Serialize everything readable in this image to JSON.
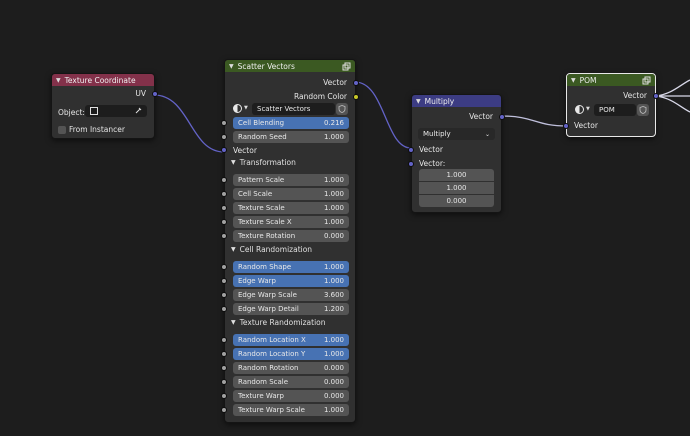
{
  "colors": {
    "background": "#1d1d1d",
    "node_body": "#303030",
    "header_input": "#83314a",
    "header_group": "#3b5922",
    "header_vector": "#3c3c83",
    "socket_vector": "#6363c7",
    "socket_color": "#c7c729",
    "socket_float": "#a1a1a1",
    "field_selected": "#4772b3",
    "field_default": "#545454"
  },
  "texture_coordinate": {
    "title": "Texture Coordinate",
    "output_uv": "UV",
    "object_label": "Object:",
    "from_instancer": "From Instancer"
  },
  "scatter_vectors": {
    "title": "Scatter Vectors",
    "output_vector": "Vector",
    "output_random_color": "Random Color",
    "group_name": "Scatter Vectors",
    "cell_blending": {
      "label": "Cell Blending",
      "value": "0.216"
    },
    "random_seed": {
      "label": "Random Seed",
      "value": "1.000"
    },
    "input_vector": "Vector",
    "transformation": {
      "title": "Transformation",
      "fields": [
        {
          "label": "Pattern Scale",
          "value": "1.000"
        },
        {
          "label": "Cell Scale",
          "value": "1.000"
        },
        {
          "label": "Texture Scale",
          "value": "1.000"
        },
        {
          "label": "Texture Scale X",
          "value": "1.000"
        },
        {
          "label": "Texture Rotation",
          "value": "0.000"
        }
      ]
    },
    "cell_randomization": {
      "title": "Cell Randomization",
      "fields": [
        {
          "label": "Random Shape",
          "value": "1.000"
        },
        {
          "label": "Edge Warp",
          "value": "1.000"
        },
        {
          "label": "Edge Warp Scale",
          "value": "3.600"
        },
        {
          "label": "Edge Warp Detail",
          "value": "1.200"
        }
      ]
    },
    "texture_randomization": {
      "title": "Texture Randomization",
      "fields": [
        {
          "label": "Random Location X",
          "value": "1.000"
        },
        {
          "label": "Random Location Y",
          "value": "1.000"
        },
        {
          "label": "Random Rotation",
          "value": "0.000"
        },
        {
          "label": "Random Scale",
          "value": "0.000"
        },
        {
          "label": "Texture Warp",
          "value": "0.000"
        },
        {
          "label": "Texture Warp Scale",
          "value": "1.000"
        }
      ]
    }
  },
  "multiply": {
    "title": "Multiply",
    "output_vector": "Vector",
    "operation": "Multiply",
    "input_vector": "Vector",
    "input_vector_b": "Vector:",
    "values": [
      "1.000",
      "1.000",
      "0.000"
    ]
  },
  "pom": {
    "title": "POM",
    "output_vector": "Vector",
    "group_name": "POM",
    "input_vector": "Vector"
  }
}
